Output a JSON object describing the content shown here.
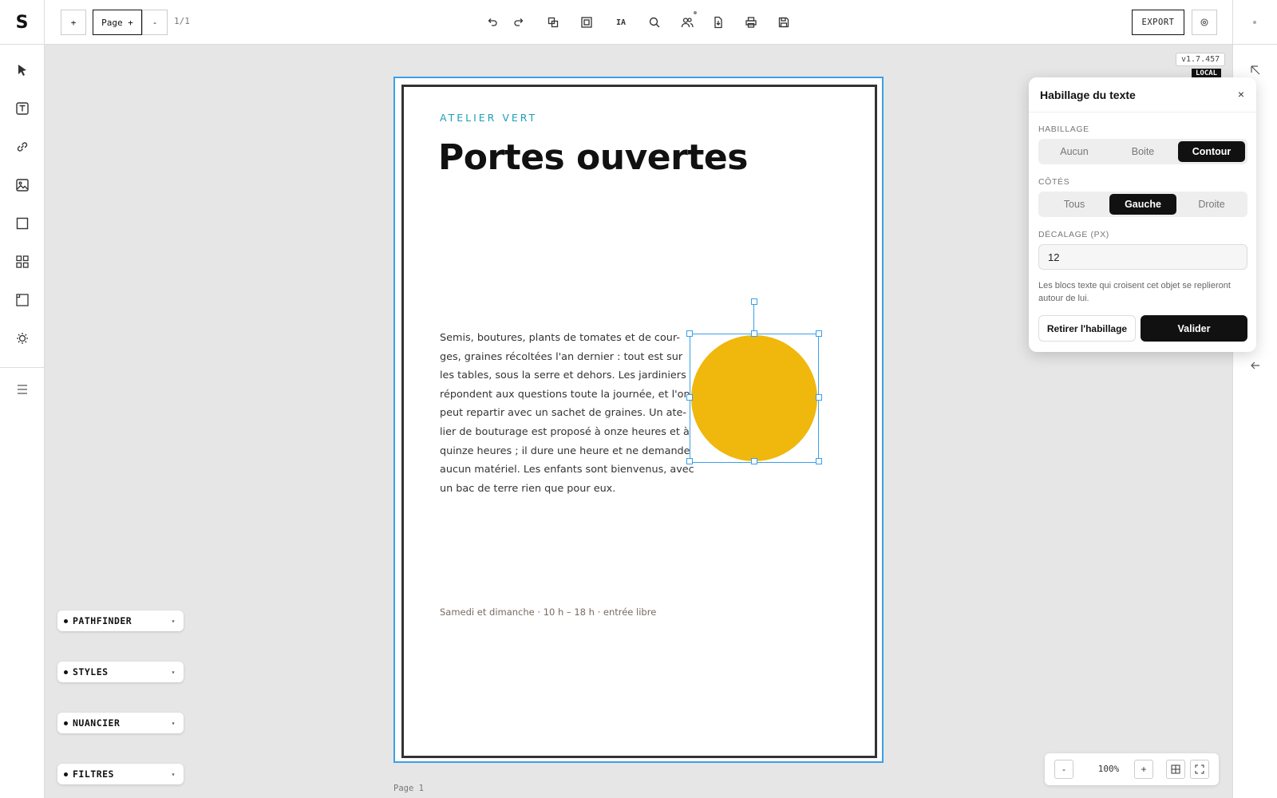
{
  "app": {
    "logo": "S"
  },
  "toolbar": {
    "add_label": "+",
    "page_menu_label": "Page +",
    "remove_label": "-",
    "page_count": "1/1",
    "ia_label": "IA",
    "export_label": "EXPORT",
    "icons": [
      "undo-icon",
      "redo-icon",
      "duplicate-icon",
      "frame-icon",
      "ia-icon",
      "search-icon",
      "collaborators-icon",
      "import-icon",
      "print-icon",
      "save-icon"
    ]
  },
  "left_tools": [
    "select-arrow-icon",
    "text-tool-icon",
    "link-icon",
    "image-icon",
    "rectangle-icon",
    "grid-icon",
    "ruler-icon",
    "light-icon",
    "menu-icon"
  ],
  "version": {
    "number": "v1.7.457",
    "badge": "LOCAL"
  },
  "document": {
    "brand": "ATELIER VERT",
    "title": "Portes ouvertes",
    "body_lines": [
      "Semis, boutures, plants de tomates et de cour-",
      "ges, graines récoltées l'an dernier : tout est sur",
      "les tables, sous la serre et dehors. Les jardiniers",
      "répondent aux questions toute la journée, et l'on",
      "peut repartir avec un sachet de graines. Un ate-",
      "lier de bouturage est proposé à onze heures et à",
      "quinze heures ; il dure une heure et ne demande",
      "aucun matériel. Les enfants sont bienvenus, avec",
      "un bac de terre rien que pour eux."
    ],
    "footer": "Samedi et dimanche · 10 h – 18 h · entrée libre",
    "page_label": "Page 1",
    "circle_color": "#f0b70c"
  },
  "panels": {
    "pathfinder": "PATHFINDER",
    "styles": "STYLES",
    "nuancier": "NUANCIER",
    "filtres": "FILTRES"
  },
  "dialog": {
    "title": "Habillage du texte",
    "close": "×",
    "wrap_label": "HABILLAGE",
    "wrap_options": [
      "Aucun",
      "Boite",
      "Contour"
    ],
    "wrap_selected": "Contour",
    "sides_label": "CÔTÉS",
    "sides_options": [
      "Tous",
      "Gauche",
      "Droite"
    ],
    "sides_selected": "Gauche",
    "offset_label": "DÉCALAGE (PX)",
    "offset_value": "12",
    "hint": "Les blocs texte qui croisent cet objet se replieront autour de lui.",
    "remove_button": "Retirer l'habillage",
    "confirm_button": "Valider"
  },
  "zoom": {
    "minus": "-",
    "value": "100%",
    "plus": "+"
  },
  "colors": {
    "accent_blue": "#3aa0e8",
    "brand_teal": "#1a9fb8",
    "dark": "#111111"
  }
}
